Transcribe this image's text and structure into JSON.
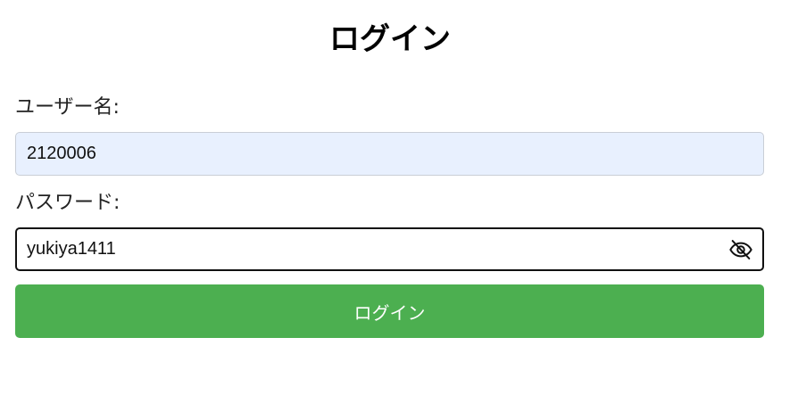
{
  "login_form": {
    "title": "ログイン",
    "username_label": "ユーザー名:",
    "username_value": "2120006",
    "password_label": "パスワード:",
    "password_value": "yukiya1411",
    "password_visibility_icon": "eye-slash-icon",
    "submit_label": "ログイン"
  },
  "colors": {
    "button_background": "#4caf50",
    "username_field_background": "#e8f0fe"
  }
}
